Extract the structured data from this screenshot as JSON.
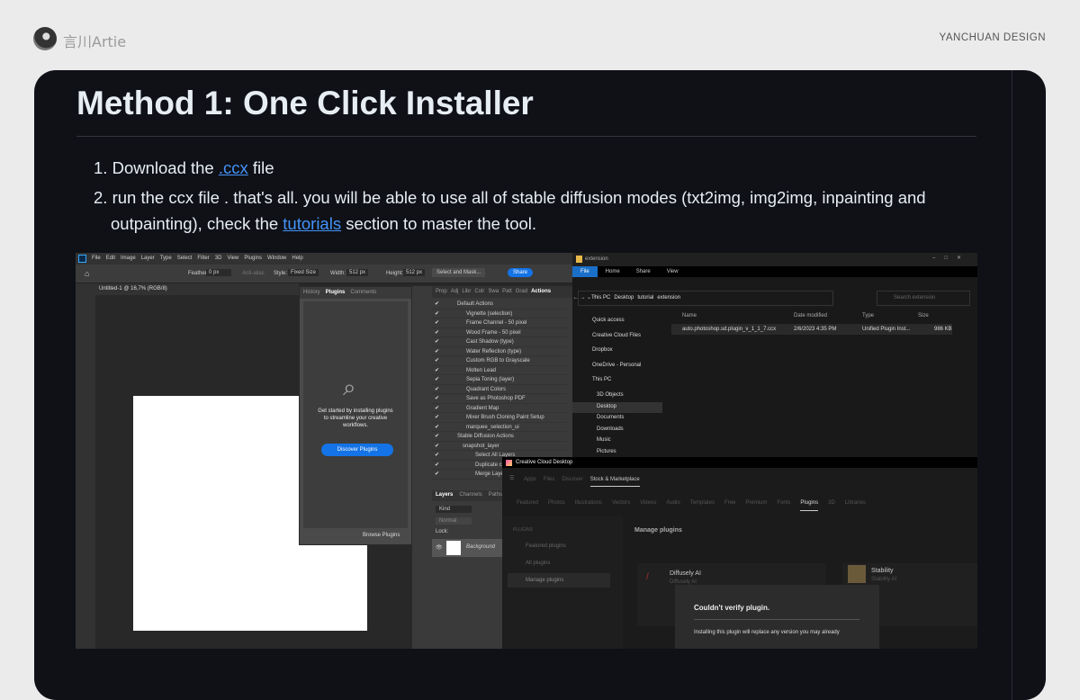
{
  "header": {
    "author": "言川Artie",
    "brand": "YANCHUAN DESIGN"
  },
  "article": {
    "title": "Method 1: One Click Installer",
    "steps": [
      {
        "num": "1.",
        "pre": "Download the ",
        "link": ".ccx",
        "post": " file"
      },
      {
        "num": "2.",
        "pre": "run the ccx file . that's all. you will be able to use all of stable diffusion modes (txt2img, img2img, inpainting and",
        "pre2": "outpainting), check the ",
        "link": "tutorials",
        "post": " section to master the tool."
      }
    ]
  },
  "photoshop": {
    "menu": [
      "File",
      "Edit",
      "Image",
      "Layer",
      "Type",
      "Select",
      "Filter",
      "3D",
      "View",
      "Plugins",
      "Window",
      "Help"
    ],
    "options": {
      "feather_label": "Feather:",
      "feather": "0 px",
      "antialias": "Anti-alias",
      "style_label": "Style:",
      "style": "Fixed Size",
      "width_label": "Width:",
      "width": "512 px",
      "height_label": "Height:",
      "height": "512 px",
      "select_mask": "Select and Mask...",
      "share": "Share"
    },
    "doc_tab": "Untitled-1 @ 16,7% (RGB/8)",
    "plugins_panel": {
      "tabs": [
        "History",
        "Plugins",
        "Comments"
      ],
      "message": "Get started by installing plugins to streamline your creative workflows.",
      "discover": "Discover Plugins",
      "browse": "Browse Plugins"
    },
    "actions_panel": {
      "tabs": [
        "Prop",
        "Adj",
        "Libr",
        "Colr",
        "Swa",
        "Patt",
        "Grad",
        "Actions"
      ],
      "items": [
        "Default Actions",
        "Vignette (selection)",
        "Frame Channel - 50 pixel",
        "Wood Frame - 50 pixel",
        "Cast Shadow (type)",
        "Water Reflection (type)",
        "Custom RGB to Grayscale",
        "Molten Lead",
        "Sepia Toning (layer)",
        "Quadrant Colors",
        "Save as Photoshop PDF",
        "Gradient Map",
        "Mixer Brush Cloning Paint Setup",
        "marquee_selection_ui",
        "Stable Diffusion Actions",
        "snapshot_layer",
        "Select All Layers",
        "Duplicate c...",
        "Merge Laye..."
      ]
    },
    "layers_panel": {
      "tabs": [
        "Layers",
        "Channels",
        "Paths"
      ],
      "kind": "Kind",
      "mode": "Normal",
      "lock": "Lock:",
      "layer": "Background"
    }
  },
  "explorer": {
    "title": "extension",
    "ribbon": [
      "File",
      "Home",
      "Share",
      "View"
    ],
    "breadcrumb": [
      "This PC",
      "Desktop",
      "tutorial",
      "extension"
    ],
    "search_placeholder": "Search extension",
    "nav": [
      "Quick access",
      "Creative Cloud Files",
      "Dropbox",
      "OneDrive - Personal",
      "This PC",
      "3D Objects",
      "Desktop",
      "Documents",
      "Downloads",
      "Music",
      "Pictures"
    ],
    "columns": [
      "Name",
      "Date modified",
      "Type",
      "Size"
    ],
    "file": {
      "name": "auto.photoshop.sd.plugin_v_1_1_7.ccx",
      "date": "2/6/2023 4:35 PM",
      "type": "Unified Plugin Inst...",
      "size": "986 KB"
    }
  },
  "creative_cloud": {
    "title": "Creative Cloud Desktop",
    "nav": [
      "Apps",
      "Files",
      "Discover",
      "Stock & Marketplace"
    ],
    "subtabs": [
      "Featured",
      "Photos",
      "Illustrations",
      "Vectors",
      "Videos",
      "Audio",
      "Templates",
      "Free",
      "Premium",
      "Fonts",
      "Plugins",
      "3D",
      "Libraries"
    ],
    "sidebar_heading": "PLUGINS",
    "sidebar": [
      "Featured plugins",
      "All plugins",
      "Manage plugins"
    ],
    "content_title": "Manage plugins",
    "cards": [
      {
        "name": "Diffusely AI",
        "sub": "Diffusely AI"
      },
      {
        "name": "Stability",
        "sub": "Stability AI"
      }
    ],
    "dialog": {
      "title": "Couldn't verify plugin.",
      "body": "Installing this plugin will replace any version you may already"
    }
  }
}
